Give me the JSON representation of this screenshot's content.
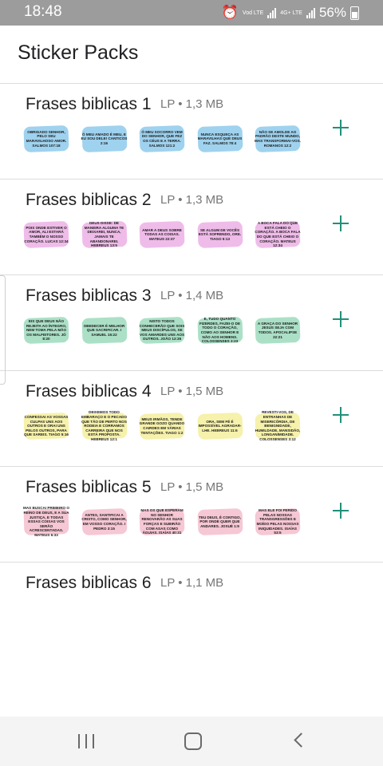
{
  "status": {
    "time": "18:48",
    "network": "Vod LTE",
    "network2": "4G+ LTE",
    "battery": "56%"
  },
  "title": "Sticker Packs",
  "colors": {
    "accent": "#21907a",
    "blue": "#7fc3e8",
    "pink": "#e9a6e2",
    "green": "#8fd6b4",
    "yellow": "#f3ec8f",
    "rose": "#f3b4c6"
  },
  "packs": [
    {
      "name": "Frases biblicas 1",
      "meta": "LP • 1,3 MB",
      "stickers": [
        {
          "color": "blue",
          "text": "OBRIGADO SENHOR, PELO SEU MARAVILHOSO AMOR. SALMOS 107:18"
        },
        {
          "color": "blue",
          "text": "Ó MEU AMADO É MEU, E EU SOU DELE! CANTICOS 2:16"
        },
        {
          "color": "blue",
          "text": "Ó MEU SOCORRO VEM DO SENHOR, QUE FEZ OS CÉUS E A TERRA. SALMOS 121:2"
        },
        {
          "color": "blue",
          "text": "NUNCA ESQUEÇA AS MARAVILHAS QUE DEUS FAZ. SALMOS 78:4"
        },
        {
          "color": "blue",
          "text": "NÃO SE AMOLDE AO PADRÃO DESTE MUNDO, MAS TRANSFORMAI-VOS. ROMANOS 12:2"
        }
      ]
    },
    {
      "name": "Frases biblicas 2",
      "meta": "LP • 1,3 MB",
      "stickers": [
        {
          "color": "pink",
          "text": "POIS ONDE ESTIVER O AMOR, ALI ESTARÁ TAMBÉM O NOSSO CORAÇÃO. LUCAS 12:34"
        },
        {
          "color": "pink",
          "text": "DEUS DISSE: DE MANEIRA ALGUMA TE DEIXAREI, NUNCA, JAMAIS TE ABANDONAREI. HEBREUS 13:5"
        },
        {
          "color": "pink",
          "text": "AMAR A DEUS SOBRE TODAS AS COISAS. MATEUS 22:37"
        },
        {
          "color": "pink",
          "text": "SE ALGUM DE VOCÊS ESTÁ SOFRENDO, ORE. TIAGO 5:13"
        },
        {
          "color": "pink",
          "text": "A BOCA FALA DO QUE ESTÁ CHEIO O CORAÇÃO. A BOCA FALA DO QUE ESTÁ CHEIO O CORAÇÃO. MATEUS 12:34"
        }
      ]
    },
    {
      "name": "Frases biblicas 3",
      "meta": "LP • 1,4 MB",
      "stickers": [
        {
          "color": "green",
          "text": "EIS QUE DEUS NÃO REJEITA AO ÍNTEGRO, NEM TOMA PELA MÃO OS MALFEITORES. JÓ 8:20"
        },
        {
          "color": "green",
          "text": "OBEDECER É MELHOR QUE SACRIFICAR. I SAMUEL 15:22"
        },
        {
          "color": "green",
          "text": "NISTO TODOS CONHECERÃO QUE SOIS MEUS DISCÍPULOS, SE VOS AMARDES UNS AOS OUTROS. JOÃO 13:35"
        },
        {
          "color": "green",
          "text": "E, TUDO QUANTO FIZERDES, FAZEI-O DE TODO O CORAÇÃO, COMO AO SENHOR E NÃO AOS HOMENS. COLOSSENSES 3:23"
        },
        {
          "color": "green",
          "text": "A GRAÇA DO SENHOR JESUS SEJA COM TODOS. APOCALIPSE 22:21"
        }
      ]
    },
    {
      "name": "Frases biblicas 4",
      "meta": "LP • 1,5 MB",
      "stickers": [
        {
          "color": "yellow",
          "text": "CONFESSAI AS VOSSAS CULPAS UNS AOS OUTROS E ORAI UNS PELOS OUTROS, PARA QUE SAREIS. TIAGO 5:16"
        },
        {
          "color": "yellow",
          "text": "DEIXEMOS TODO EMBARAÇO E O PECADO QUE TÃO DE PERTO NOS RODEIA E CORRAMOS CARREIRA QUE NOS ESTÁ PROPOSTA. HEBREUS 12:1"
        },
        {
          "color": "yellow",
          "text": "MEUS IRMÃOS, TENDE GRANDE GOZO QUANDO CAIRDES EM VÁRIAS TENTAÇÕES. TIAGO 1:2"
        },
        {
          "color": "yellow",
          "text": "ORA, SEM FÉ É IMPOSSÍVEL AGRADAR-LHE. HEBREUS 11:6"
        },
        {
          "color": "yellow",
          "text": "REVESTI-VOS, DE ENTRANHAS DE MISERICÓRDIA, DE BENIGNIDADE, HUMILDADE, MANSIDÃO, LONGANIMIDADE. COLOSSENSES 3:12"
        }
      ]
    },
    {
      "name": "Frases biblicas 5",
      "meta": "LP • 1,5 MB",
      "stickers": [
        {
          "color": "rose",
          "text": "MAS BUSCAI PRIMEIRO O REINO DE DEUS, E A SUA JUSTIÇA, E TODAS ESSAS COISAS VOS SERÃO ACRESCENTADAS. MATEUS 6:33"
        },
        {
          "color": "rose",
          "text": "ANTES, SANTIFICAI A CRISTO, COMO SENHOR, EM VOSSO CORAÇÃO. I PEDRO 3:15"
        },
        {
          "color": "rose",
          "text": "MAS OS QUE ESPERAM NO SENHOR RENOVARÃO AS SUAS FORÇAS E SUBIRÃO COM ASAS COMO ÁGUIAS. ISAÍAS 40:31"
        },
        {
          "color": "rose",
          "text": "TEU DEUS, É CONTIGO, POR ONDE QUER QUE ANDARES. JOSUÉ 1:9"
        },
        {
          "color": "rose",
          "text": "MAS ELE FOI FERIDO PELAS NOSSAS TRANSGRESSÕES E MOÍDO PELAS NOSSAS INIQUIDADES. ISAÍAS 53:5"
        }
      ]
    },
    {
      "name": "Frases biblicas 6",
      "meta": "LP • 1,1 MB",
      "stickers": []
    }
  ]
}
